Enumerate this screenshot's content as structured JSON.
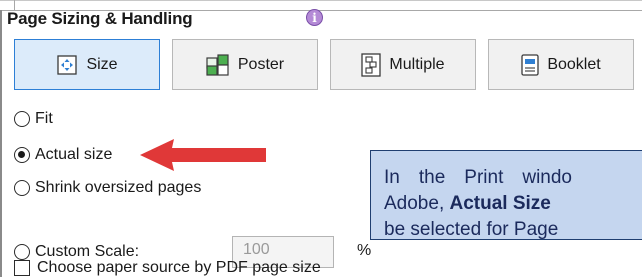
{
  "group": {
    "title": "Page Sizing & Handling",
    "info_icon": "info-icon"
  },
  "mode_buttons": [
    {
      "label": "Size",
      "icon": "size-icon",
      "selected": true
    },
    {
      "label": "Poster",
      "icon": "poster-icon",
      "selected": false
    },
    {
      "label": "Multiple",
      "icon": "multiple-icon",
      "selected": false
    },
    {
      "label": "Booklet",
      "icon": "booklet-icon",
      "selected": false
    }
  ],
  "options": [
    {
      "label": "Fit",
      "checked": false
    },
    {
      "label": "Actual size",
      "checked": true
    },
    {
      "label": "Shrink oversized pages",
      "checked": false
    },
    {
      "label": "Custom Scale:",
      "checked": false
    }
  ],
  "custom_scale": {
    "value": "100",
    "unit": "%"
  },
  "paper_source_checkbox": {
    "label": "Choose paper source by PDF page size",
    "checked": false
  },
  "callout": {
    "line1": [
      "In",
      "the",
      "Print",
      "windo"
    ],
    "line2_prefix": "Adobe, ",
    "line2_bold": "Actual Size",
    "line3": "be selected for Page"
  },
  "colors": {
    "selected_button_bg": "#dcebfa",
    "selected_button_border": "#2d7fd6",
    "arrow": "#e03838",
    "callout_bg": "#c5d6ef",
    "callout_border": "#1f3e70",
    "callout_text": "#1b2a5c"
  }
}
